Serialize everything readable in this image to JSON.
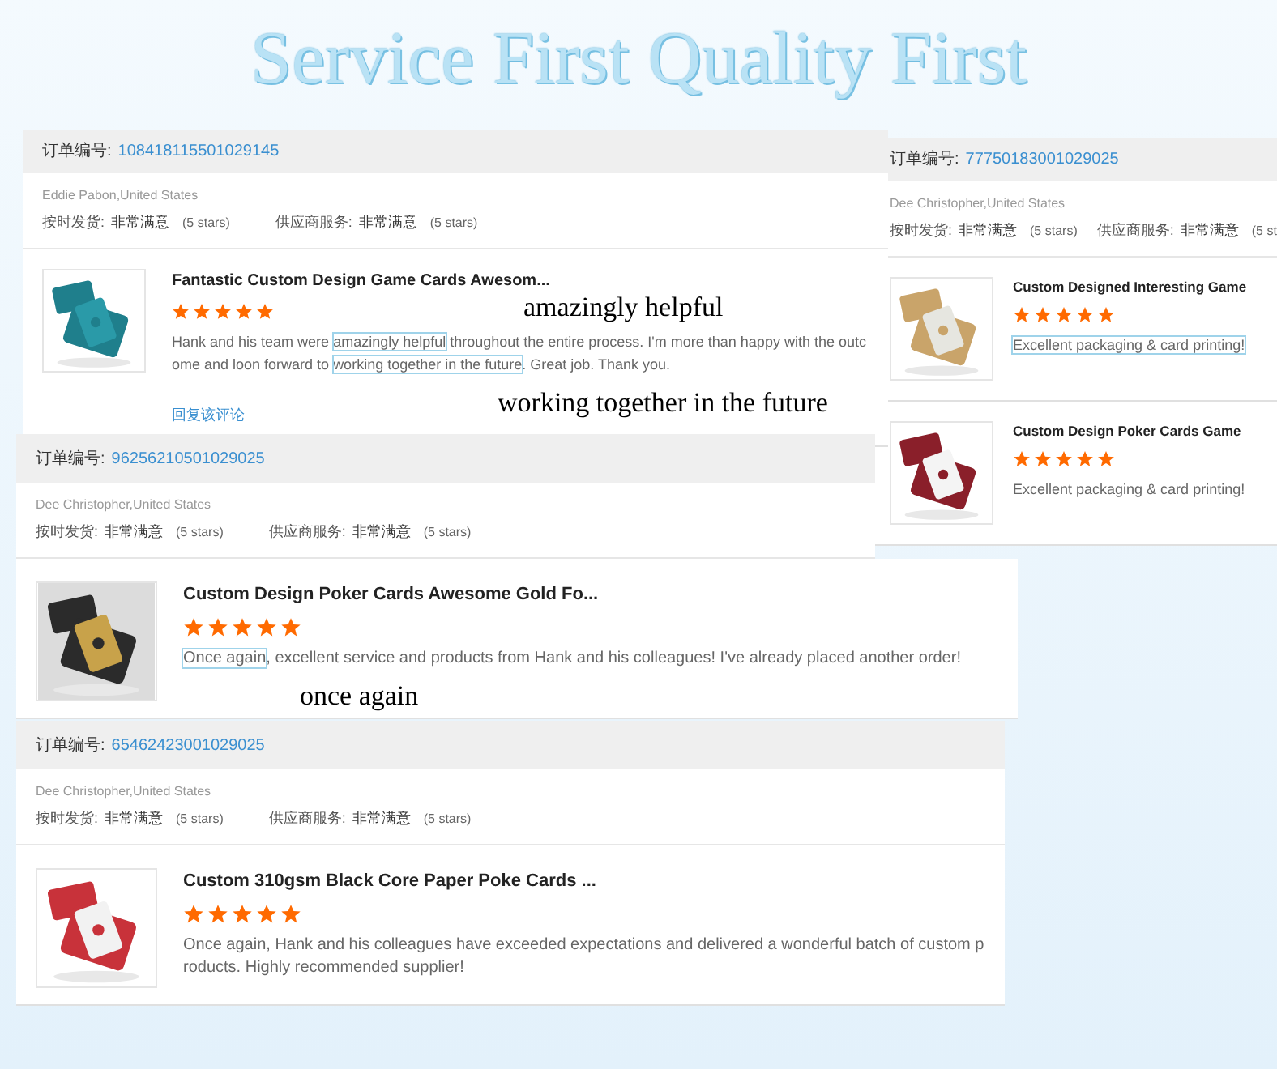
{
  "title": "Service First Quality First",
  "orders": [
    {
      "order_label": "订单编号:",
      "order_number": "108418115501029145",
      "buyer": "Eddie Pabon,United States",
      "ratings": [
        {
          "label": "按时发货:",
          "value": "非常满意",
          "stars_text": "(5 stars)"
        },
        {
          "label": "供应商服务:",
          "value": "非常满意",
          "stars_text": "(5 stars)"
        }
      ],
      "items": [
        {
          "title": "Fantastic Custom Design Game Cards Awesom...",
          "stars": 5,
          "review": [
            {
              "text": "Hank and his team were ",
              "boxed": false
            },
            {
              "text": "amazingly helpful",
              "boxed": true
            },
            {
              "text": " throughout the entire process. I'm more than happy with the outcome and loon forward to ",
              "boxed": false
            },
            {
              "text": "working together in the future",
              "boxed": true
            },
            {
              "text": ". Great job. Thank you.",
              "boxed": false
            }
          ]
        }
      ],
      "reply_link": "回复该评论"
    },
    {
      "order_label": "订单编号:",
      "order_number": "77750183001029025",
      "buyer": "Dee Christopher,United States",
      "ratings": [
        {
          "label": "按时发货:",
          "value": "非常满意",
          "stars_text": "(5 stars)"
        },
        {
          "label": "供应商服务:",
          "value": "非常满意",
          "stars_text": "(5 st"
        }
      ],
      "items": [
        {
          "title": "Custom Designed Interesting Game",
          "stars": 5,
          "review": [
            {
              "text": "Excellent packaging & card printing!",
              "boxed": true
            }
          ]
        },
        {
          "title": "Custom Design Poker Cards Game",
          "stars": 5,
          "review": [
            {
              "text": "Excellent packaging & card printing!",
              "boxed": false
            }
          ]
        }
      ]
    },
    {
      "order_label": "订单编号:",
      "order_number": "96256210501029025",
      "buyer": "Dee Christopher,United States",
      "ratings": [
        {
          "label": "按时发货:",
          "value": "非常满意",
          "stars_text": "(5 stars)"
        },
        {
          "label": "供应商服务:",
          "value": "非常满意",
          "stars_text": "(5 stars)"
        }
      ],
      "items": [
        {
          "title": "Custom Design Poker Cards Awesome Gold Fo...",
          "stars": 5,
          "review": [
            {
              "text": "Once again",
              "boxed": true
            },
            {
              "text": ", excellent service and products from Hank and his colleagues! I've already placed another order!",
              "boxed": false
            }
          ]
        }
      ]
    },
    {
      "order_label": "订单编号:",
      "order_number": "65462423001029025",
      "buyer": "Dee Christopher,United States",
      "ratings": [
        {
          "label": "按时发货:",
          "value": "非常满意",
          "stars_text": "(5 stars)"
        },
        {
          "label": "供应商服务:",
          "value": "非常满意",
          "stars_text": "(5 stars)"
        }
      ],
      "items": [
        {
          "title": "Custom 310gsm Black Core Paper Poke Cards ...",
          "stars": 5,
          "review": [
            {
              "text": "Once again, Hank and his colleagues have exceeded expectations and delivered a wonderful batch of custom products. Highly recommended supplier!",
              "boxed": false
            }
          ]
        }
      ]
    }
  ],
  "annotations": [
    "amazingly helpful",
    "working together in the future",
    "once again"
  ]
}
